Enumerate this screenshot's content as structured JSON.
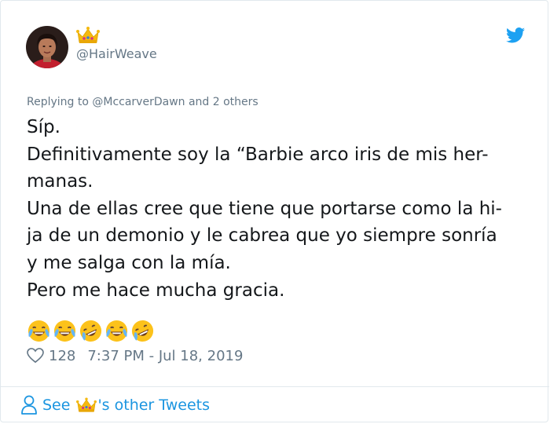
{
  "tweet": {
    "handle": "@HairWeave",
    "replying_to": "Replying to @MccarverDawn and 2 others",
    "lines": [
      "Síp.",
      "Definitivamente soy la “Barbie arco iris de mis her-",
      "manas.",
      "Una de ellas cree que tiene que portarse como la hi-",
      "ja de un demonio y le cabrea que yo siempre sonría",
      "y me salga con la mía.",
      "Pero me hace mucha gracia."
    ],
    "emojis": [
      "face-with-tears-of-joy",
      "face-with-tears-of-joy",
      "rolling-on-floor-laughing",
      "face-with-tears-of-joy",
      "rolling-on-floor-laughing"
    ],
    "likes": "128",
    "timestamp": "7:37 PM - Jul 18, 2019"
  },
  "footer": {
    "see_prefix": "See",
    "see_suffix": "'s other Tweets"
  },
  "colors": {
    "link_blue": "#1b95e0",
    "muted_gray": "#657786",
    "twitter_blue": "#1da1f2"
  }
}
